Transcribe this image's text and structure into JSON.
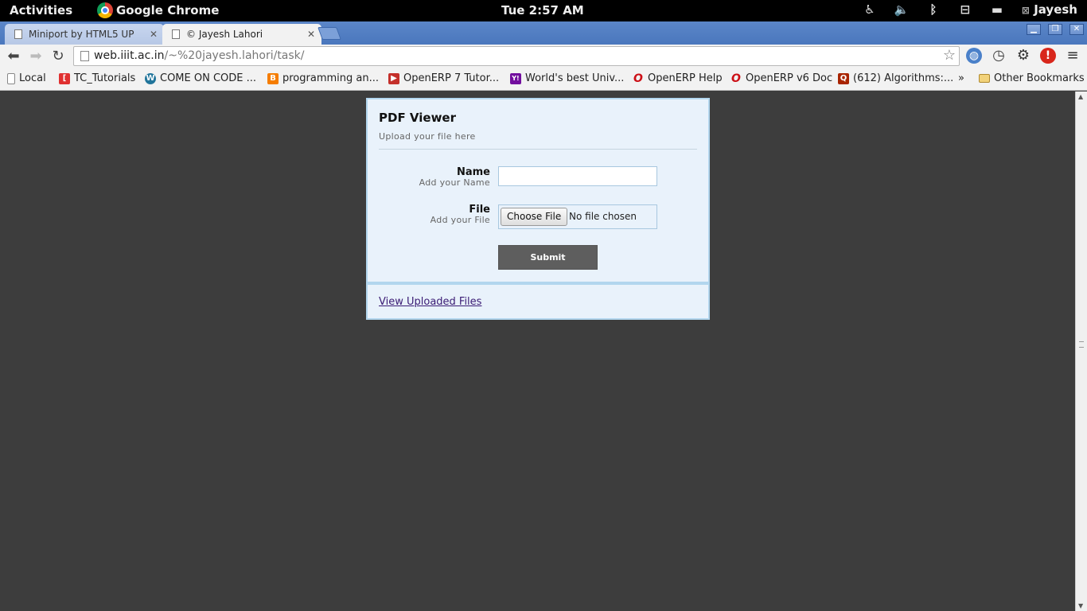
{
  "topbar": {
    "activities": "Activities",
    "app_name": "Google Chrome",
    "clock": "Tue  2:57 AM",
    "user": "Jayesh"
  },
  "tabs": [
    {
      "label": "Miniport by HTML5 UP",
      "active": false
    },
    {
      "label": "© Jayesh Lahori",
      "active": true
    }
  ],
  "toolbar": {
    "url_host": "web.iiit.ac.in",
    "url_path": "/~%20jayesh.lahori/task/"
  },
  "bookmarks": {
    "items": [
      {
        "label": "Local",
        "icon": "page-icon"
      },
      {
        "label": "TC_Tutorials",
        "icon": "topcoder-icon",
        "color": "#e03030"
      },
      {
        "label": "COME ON CODE ...",
        "icon": "wordpress-icon",
        "color": "#21759b"
      },
      {
        "label": "programming an...",
        "icon": "blogger-icon",
        "color": "#f57d00"
      },
      {
        "label": "OpenERP 7 Tutor...",
        "icon": "youtube-icon",
        "color": "#c4302b"
      },
      {
        "label": "World's best Univ...",
        "icon": "yahoo-icon",
        "color": "#720e9e"
      },
      {
        "label": "OpenERP Help",
        "icon": "opera-icon",
        "color": "#cc0f16"
      },
      {
        "label": "OpenERP v6 Doc",
        "icon": "opera-icon",
        "color": "#cc0f16"
      },
      {
        "label": "(612) Algorithms:...",
        "icon": "quora-icon",
        "color": "#a82400"
      }
    ],
    "overflow": "»",
    "other": "Other Bookmarks"
  },
  "page": {
    "title": "PDF Viewer",
    "subtitle": "Upload your file here",
    "name_label": "Name",
    "name_hint": "Add your Name",
    "name_value": "",
    "file_label": "File",
    "file_hint": "Add your File",
    "choose_button": "Choose File",
    "no_file": "No file chosen",
    "submit": "Submit",
    "view_link": "View Uploaded Files"
  },
  "colors": {
    "page_background": "#3d3d3d",
    "card_background": "#e9f2fb",
    "card_border": "#b2d6ee",
    "submit_background": "#5e5e5e",
    "link_color": "#3a1b74"
  }
}
